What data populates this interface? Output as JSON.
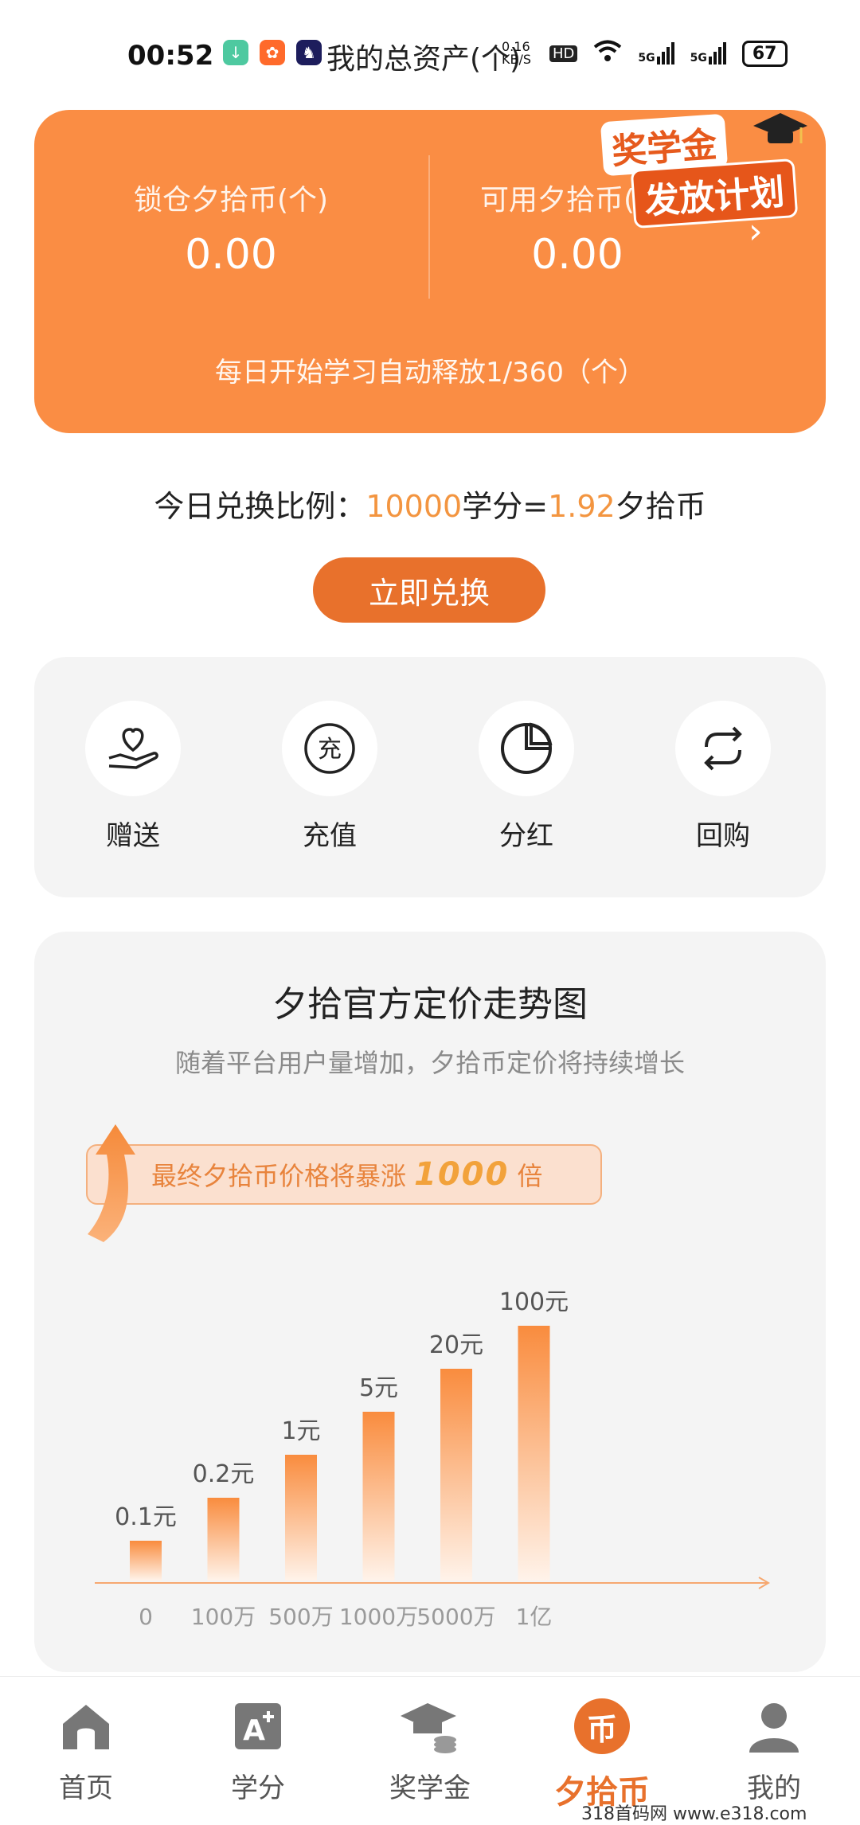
{
  "status_bar": {
    "time": "00:52",
    "overlay_title": "我的总资产(个)",
    "net_speed": "0.16 KB/S",
    "hd": "HD",
    "signal1": "5G",
    "signal2": "5G",
    "battery": "67"
  },
  "hero": {
    "locked_label": "锁仓夕拾币(个)",
    "locked_value": "0.00",
    "available_label": "可用夕拾币(个)",
    "available_value": "0.00",
    "release_note": "每日开始学习自动释放1/360（个）",
    "badge_line1": "奖学金",
    "badge_line2": "发放计划",
    "chevron": "›"
  },
  "exchange": {
    "prefix": "今日兑换比例：",
    "points": "10000",
    "points_unit": "学分=",
    "coin": "1.92",
    "coin_unit": "夕拾币",
    "button_label": "立即兑换"
  },
  "actions": [
    {
      "label": "赠送",
      "icon": "gift-heart-icon"
    },
    {
      "label": "充值",
      "icon": "recharge-icon"
    },
    {
      "label": "分红",
      "icon": "pie-chart-icon"
    },
    {
      "label": "回购",
      "icon": "repurchase-icon"
    }
  ],
  "chart_section": {
    "title": "夕拾官方定价走势图",
    "subtitle": "随着平台用户量增加，夕拾币定价将持续增长",
    "promo_prefix": "最终夕拾币价格将暴涨",
    "promo_number": "1000",
    "promo_suffix": "倍"
  },
  "chart_data": {
    "type": "bar",
    "categories": [
      "0",
      "100万",
      "500万",
      "1000万",
      "5000万",
      "1亿"
    ],
    "values": [
      0.1,
      0.2,
      1,
      5,
      20,
      100
    ],
    "data_labels": [
      "0.1元",
      "0.2元",
      "1元",
      "5元",
      "20元",
      "100元"
    ],
    "title": "夕拾官方定价走势图",
    "xlabel": "",
    "ylabel": "",
    "scale": "visual-rank (bars rise evenly, not linear)",
    "colors": {
      "bar_top": "#f98c3e",
      "bar_bottom": "#fff3ea",
      "axis": "#f6a870"
    }
  },
  "nav": [
    {
      "label": "首页",
      "icon": "home-icon",
      "active": false
    },
    {
      "label": "学分",
      "icon": "credit-icon",
      "active": false
    },
    {
      "label": "奖学金",
      "icon": "scholarship-icon",
      "active": false
    },
    {
      "label": "夕拾币",
      "icon": "coin-icon",
      "active": true,
      "icon_text": "币"
    },
    {
      "label": "我的",
      "icon": "profile-icon",
      "active": false
    }
  ],
  "credit_icon_text": "A",
  "recharge_icon_text": "充",
  "watermark": "318首码网   www.e318.com",
  "colors": {
    "accent": "#fa8d44",
    "button": "#e8712c",
    "highlight": "#f39540"
  }
}
